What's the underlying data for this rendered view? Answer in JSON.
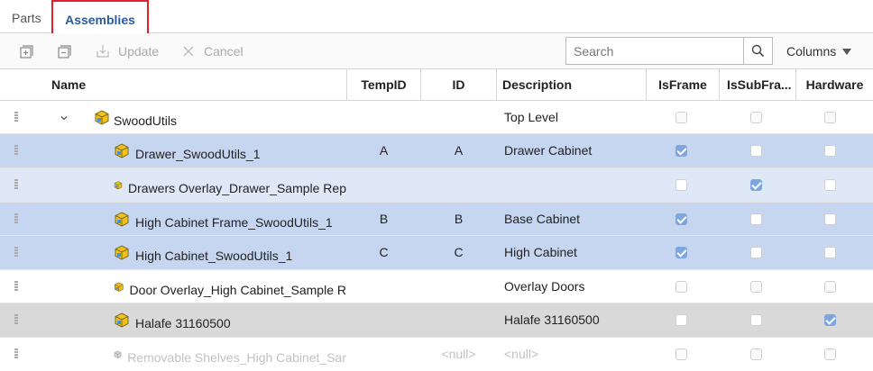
{
  "tabs": [
    {
      "label": "Parts",
      "active": false
    },
    {
      "label": "Assemblies",
      "active": true
    }
  ],
  "toolbar": {
    "expand_icon": "expand-all-icon",
    "collapse_icon": "collapse-all-icon",
    "update_label": "Update",
    "cancel_label": "Cancel",
    "search_placeholder": "Search",
    "columns_label": "Columns"
  },
  "columns": [
    "Name",
    "TempID",
    "ID",
    "Description",
    "IsFrame",
    "IsSubFra...",
    "Hardware"
  ],
  "rows": [
    {
      "name": "SwoodUtils",
      "tempid": "",
      "id": "",
      "description": "Top Level",
      "isframe": false,
      "issubframe": false,
      "hardware": false,
      "state": "normal",
      "expanded": true
    },
    {
      "name": "Drawer_SwoodUtils_1",
      "tempid": "A",
      "id": "A",
      "description": "Drawer Cabinet",
      "isframe": true,
      "issubframe": false,
      "hardware": false,
      "state": "selected"
    },
    {
      "name": "Drawers Overlay_Drawer_Sample Rep",
      "tempid": "",
      "id": "",
      "description": "",
      "isframe": false,
      "issubframe": true,
      "hardware": false,
      "state": "light"
    },
    {
      "name": "High Cabinet Frame_SwoodUtils_1",
      "tempid": "B",
      "id": "B",
      "description": "Base Cabinet",
      "isframe": true,
      "issubframe": false,
      "hardware": false,
      "state": "selected"
    },
    {
      "name": "High Cabinet_SwoodUtils_1",
      "tempid": "C",
      "id": "C",
      "description": "High Cabinet",
      "isframe": true,
      "issubframe": false,
      "hardware": false,
      "state": "selected"
    },
    {
      "name": "Door Overlay_High Cabinet_Sample R",
      "tempid": "",
      "id": "",
      "description": "Overlay Doors",
      "isframe": false,
      "issubframe": false,
      "hardware": false,
      "state": "normal"
    },
    {
      "name": "Halafe 31160500",
      "tempid": "",
      "id": "",
      "description": "Halafe 31160500",
      "isframe": false,
      "issubframe": false,
      "hardware": true,
      "state": "gray"
    },
    {
      "name": "Removable Shelves_High Cabinet_Sar",
      "tempid": "",
      "id": "<null>",
      "description": "<null>",
      "isframe": false,
      "issubframe": false,
      "hardware": false,
      "state": "faded"
    }
  ],
  "colors": {
    "selected_row": "#c6d6f0",
    "light_row": "#dfe8f7",
    "gray_row": "#d9d9d9",
    "checkbox_on": "#7ea6e0",
    "active_tab_text": "#2a5aa0",
    "highlight_border": "#e0202a"
  }
}
